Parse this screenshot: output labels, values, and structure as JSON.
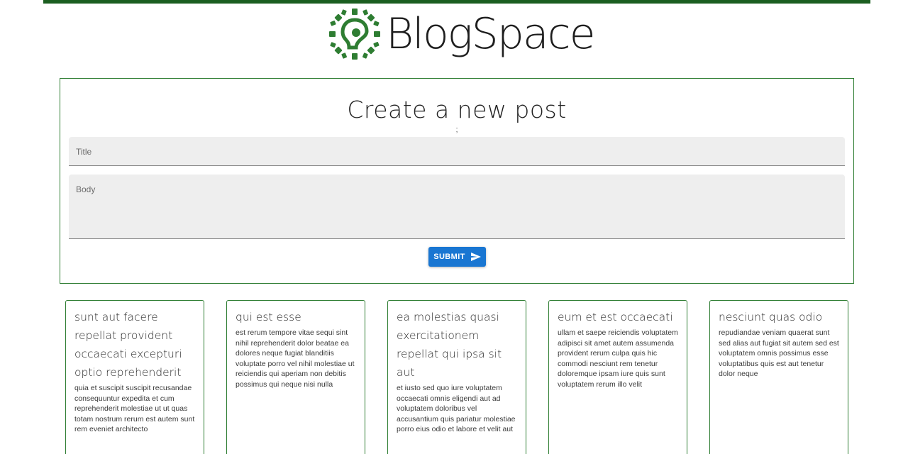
{
  "brand": {
    "name": "BlogSpace",
    "accent": "#2e7d32"
  },
  "form": {
    "heading": "Create a new post",
    "subtext": ";",
    "title_placeholder": "Title",
    "body_placeholder": "Body",
    "submit_label": "SUBMIT",
    "submit_icon": "send-icon",
    "submit_color": "#1976d2"
  },
  "posts": [
    {
      "title": "sunt aut facere repellat provident occaecati excepturi optio reprehenderit",
      "body": "quia et suscipit suscipit recusandae consequuntur expedita et cum reprehenderit molestiae ut ut quas totam nostrum rerum est autem sunt rem eveniet architecto"
    },
    {
      "title": "qui est esse",
      "body": "est rerum tempore vitae sequi sint nihil reprehenderit dolor beatae ea dolores neque fugiat blanditiis voluptate porro vel nihil molestiae ut reiciendis qui aperiam non debitis possimus qui neque nisi nulla"
    },
    {
      "title": "ea molestias quasi exercitationem repellat qui ipsa sit aut",
      "body": "et iusto sed quo iure voluptatem occaecati omnis eligendi aut ad voluptatem doloribus vel accusantium quis pariatur molestiae porro eius odio et labore et velit aut"
    },
    {
      "title": "eum et est occaecati",
      "body": "ullam et saepe reiciendis voluptatem adipisci sit amet autem assumenda provident rerum culpa quis hic commodi nesciunt rem tenetur doloremque ipsam iure quis sunt voluptatem rerum illo velit"
    },
    {
      "title": "nesciunt quas odio",
      "body": "repudiandae veniam quaerat sunt sed alias aut fugiat sit autem sed est voluptatem omnis possimus esse voluptatibus quis est aut tenetur dolor neque"
    }
  ]
}
